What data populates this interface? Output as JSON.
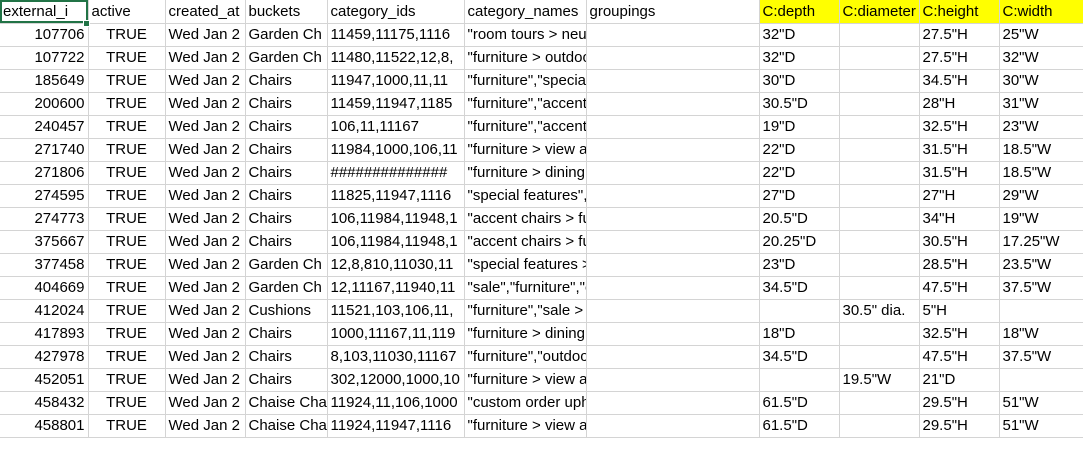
{
  "header": [
    "external_i",
    "active",
    "created_at",
    "buckets",
    "category_ids",
    "category_names",
    "groupings",
    "C:depth",
    "C:diameter",
    "C:height",
    "C:width"
  ],
  "highlighted_columns": [
    7,
    8,
    9,
    10
  ],
  "highlight_color": "#ffff00",
  "selection_color": "#217346",
  "rows": [
    [
      "107706",
      "TRUE",
      "Wed Jan 2",
      "Garden Ch",
      "11459,11175,1116",
      "\"room tours > neutral ebb > outdoor\",\"u",
      "",
      "32\"D",
      "",
      "27.5\"H",
      "25\"W"
    ],
    [
      "107722",
      "TRUE",
      "Wed Jan 2",
      "Garden Ch",
      "11480,11522,12,8,",
      "\"furniture > outdoor furniture\",\"outdoor",
      "",
      "32\"D",
      "",
      "27.5\"H",
      "32\"W"
    ],
    [
      "185649",
      "TRUE",
      "Wed Jan 2",
      "Chairs",
      "11947,1000,11,11",
      "\"furniture\",\"special features > modern le",
      "",
      "30\"D",
      "",
      "34.5\"H",
      "30\"W"
    ],
    [
      "200600",
      "TRUE",
      "Wed Jan 2",
      "Chairs",
      "11459,11947,1185",
      "\"furniture\",\"accent chairs > furniture\",\"f",
      "",
      "30.5\"D",
      "",
      "28\"H",
      "31\"W"
    ],
    [
      "240457",
      "TRUE",
      "Wed Jan 2",
      "Chairs",
      "106,11,11167",
      "\"furniture\",\"accent chairs > furniture\",\"f",
      "",
      "19\"D",
      "",
      "32.5\"H",
      "23\"W"
    ],
    [
      "271740",
      "TRUE",
      "Wed Jan 2",
      "Chairs",
      "11984,1000,106,11",
      "\"furniture > view all\",\"special features\",",
      "",
      "22\"D",
      "",
      "31.5\"H",
      "18.5\"W"
    ],
    [
      "271806",
      "TRUE",
      "Wed Jan 2",
      "Chairs",
      "##############",
      "\"furniture > dining chairs\",\"special featu",
      "",
      "22\"D",
      "",
      "31.5\"H",
      "18.5\"W"
    ],
    [
      "274595",
      "TRUE",
      "Wed Jan 2",
      "Chairs",
      "11825,11947,1116",
      "\"special features\",\"furniture > living roo",
      "",
      "27\"D",
      "",
      "27\"H",
      "29\"W"
    ],
    [
      "274773",
      "TRUE",
      "Wed Jan 2",
      "Chairs",
      "106,11984,11948,1",
      "\"accent chairs > furniture\",\"furniture > v",
      "",
      "20.5\"D",
      "",
      "34\"H",
      "19\"W"
    ],
    [
      "375667",
      "TRUE",
      "Wed Jan 2",
      "Chairs",
      "106,11984,11948,1",
      "\"accent chairs > furniture\",\"furniture > v",
      "",
      "20.25\"D",
      "",
      "30.5\"H",
      "17.25\"W"
    ],
    [
      "377458",
      "TRUE",
      "Wed Jan 2",
      "Garden Ch",
      "12,8,810,11030,11",
      "\"special features > best sellers: outdoor",
      "",
      "23\"D",
      "",
      "28.5\"H",
      "23.5\"W"
    ],
    [
      "404669",
      "TRUE",
      "Wed Jan 2",
      "Garden Ch",
      "12,11167,11940,11",
      "\"sale\",\"furniture\",\"outdoor > outdoor ch",
      "",
      "34.5\"D",
      "",
      "47.5\"H",
      "37.5\"W"
    ],
    [
      "412024",
      "TRUE",
      "Wed Jan 2",
      "Cushions",
      "11521,103,106,11,",
      "\"furniture\",\"sale > view all\",\"accent chairs > furnitu",
      "",
      "",
      "30.5\" dia.",
      "5\"H",
      ""
    ],
    [
      "417893",
      "TRUE",
      "Wed Jan 2",
      "Chairs",
      "1000,11167,11,119",
      "\"furniture > dining chairs\",\"special featu",
      "",
      "18\"D",
      "",
      "32.5\"H",
      "18\"W"
    ],
    [
      "427978",
      "TRUE",
      "Wed Jan 2",
      "Chairs",
      "8,103,11030,11167",
      "\"furniture\",\"outdoor > outdoor chairs\",\"",
      "",
      "34.5\"D",
      "",
      "47.5\"H",
      "37.5\"W"
    ],
    [
      "452051",
      "TRUE",
      "Wed Jan 2",
      "Chairs",
      "302,12000,1000,10",
      "\"furniture > view all\",\"special features > modern lea",
      "",
      "",
      "19.5\"W",
      "21\"D",
      ""
    ],
    [
      "458432",
      "TRUE",
      "Wed Jan 2",
      "Chaise Cha",
      "11924,11,106,1000",
      "\"custom order upholstery > special featu",
      "",
      "61.5\"D",
      "",
      "29.5\"H",
      "51\"W"
    ],
    [
      "458801",
      "TRUE",
      "Wed Jan 2",
      "Chaise Cha",
      "11924,11947,1116",
      "\"furniture > view all\",\"custom order uph",
      "",
      "61.5\"D",
      "",
      "29.5\"H",
      "51\"W"
    ]
  ]
}
